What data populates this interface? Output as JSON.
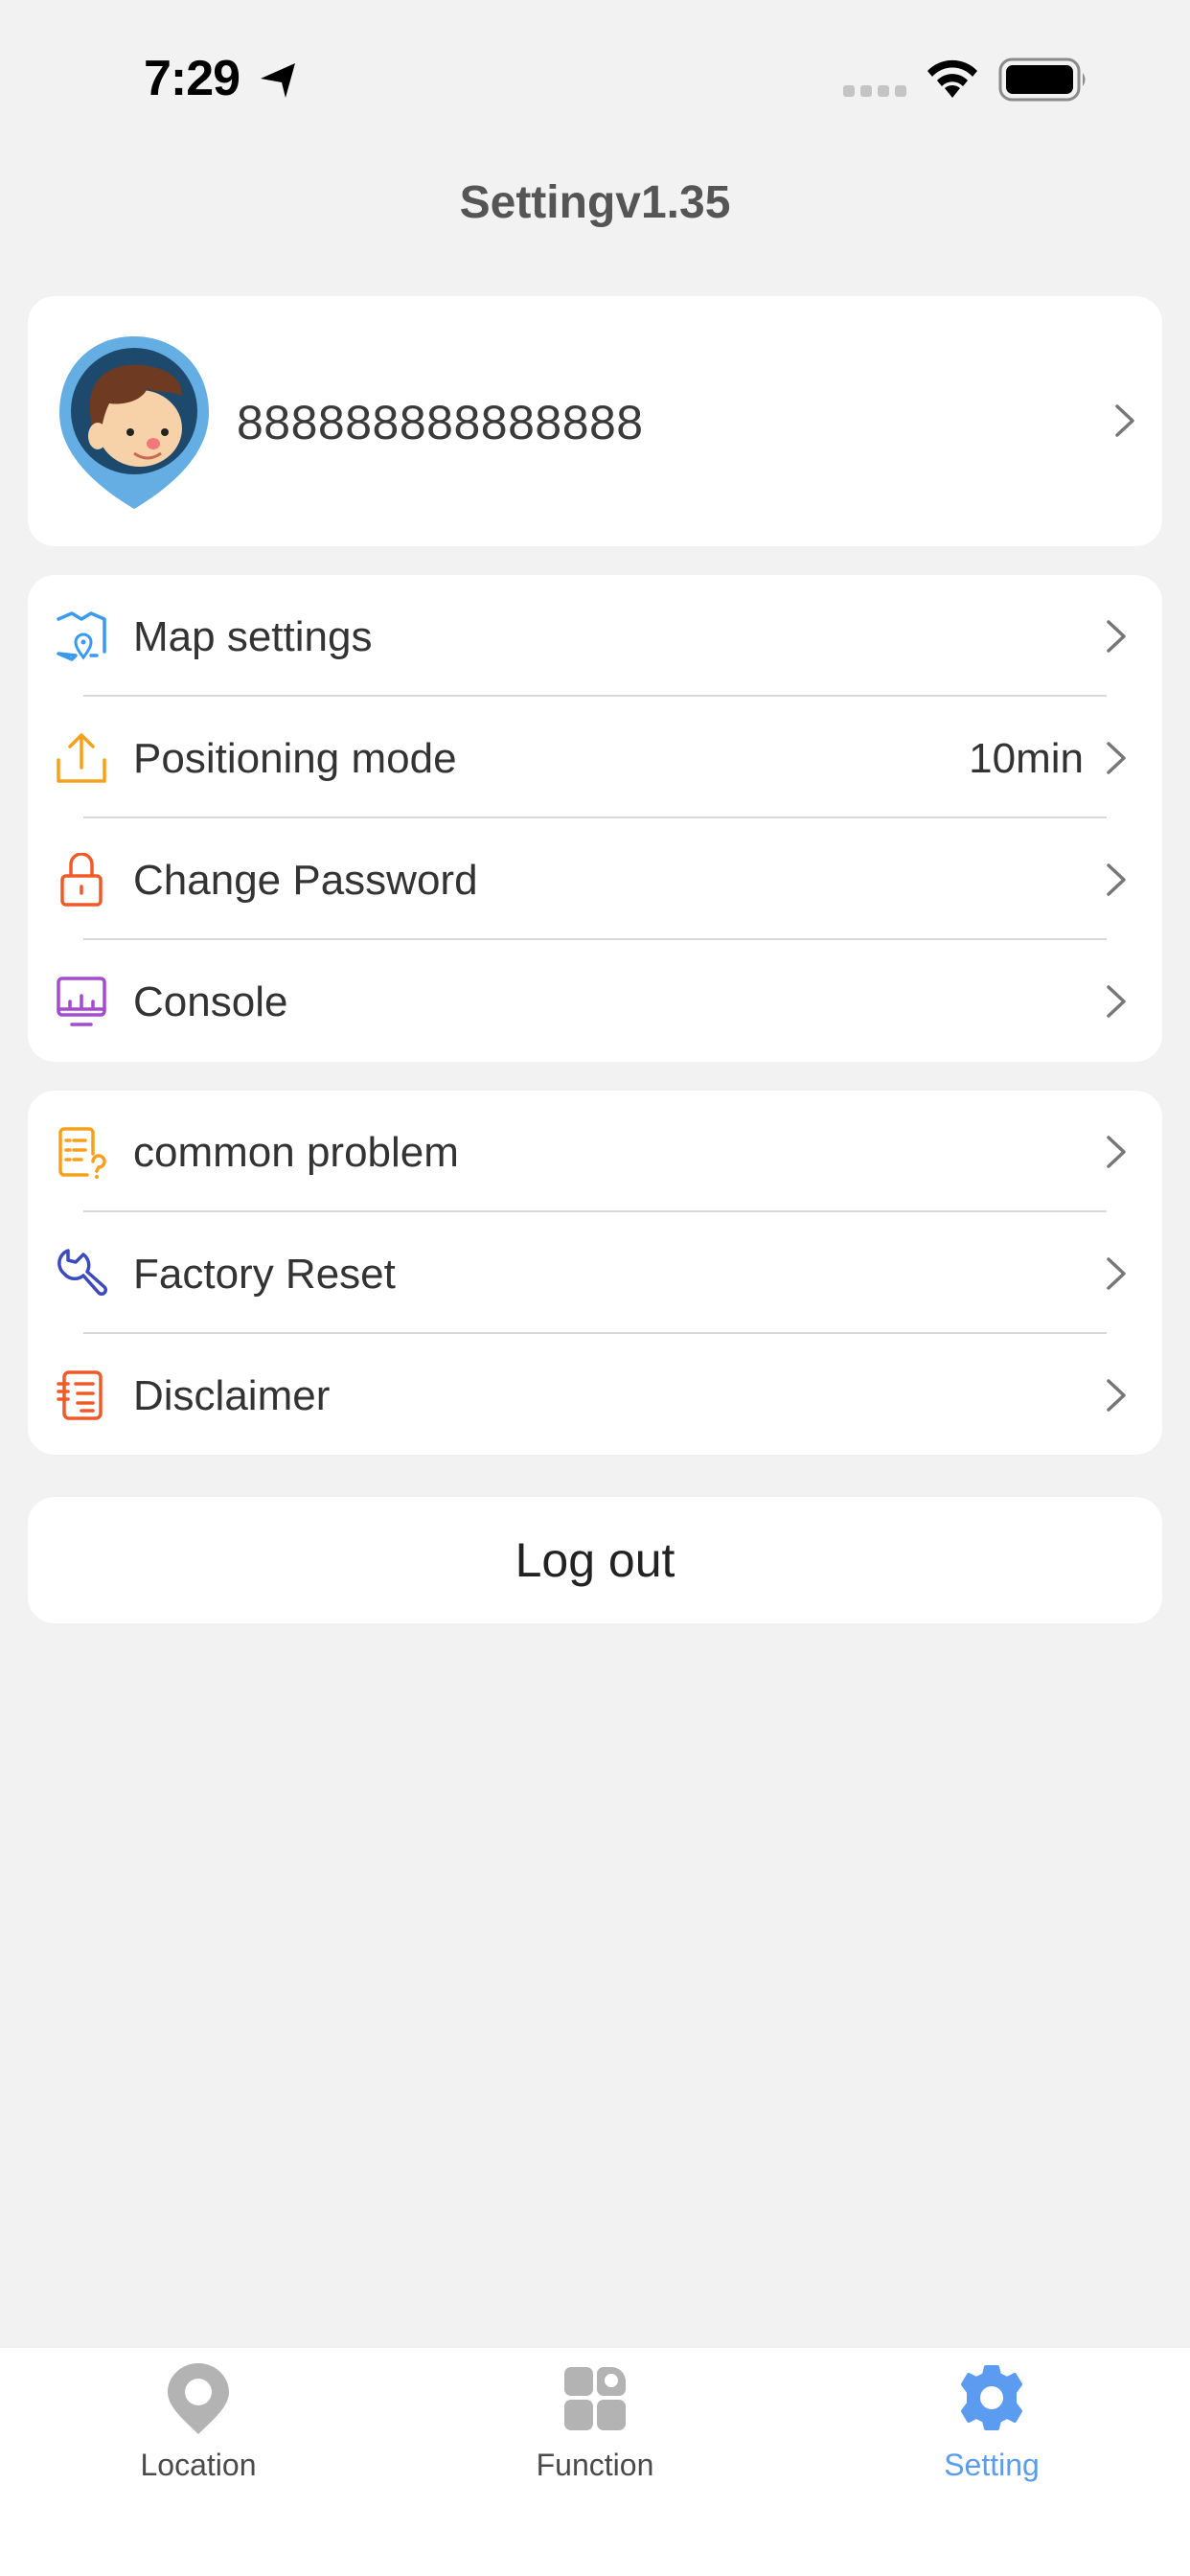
{
  "status_bar": {
    "time": "7:29",
    "location_icon": "location-arrow-icon",
    "signal_icon": "cellular-signal-icon",
    "wifi_icon": "wifi-icon",
    "battery_icon": "battery-full-icon"
  },
  "header": {
    "title": "Settingv1.35"
  },
  "profile": {
    "avatar_icon": "avatar-pin-icon",
    "name": "888888888888888",
    "chevron_icon": "chevron-right-icon"
  },
  "groups": [
    {
      "items": [
        {
          "label": "Map settings",
          "icon": "map-icon",
          "color": "#3a9af0",
          "value": ""
        },
        {
          "label": "Positioning mode",
          "icon": "upload-icon",
          "color": "#f5a11c",
          "value": "10min"
        },
        {
          "label": "Change Password",
          "icon": "lock-icon",
          "color": "#f05a28",
          "value": ""
        },
        {
          "label": "Console",
          "icon": "monitor-chart-icon",
          "color": "#a44bd0",
          "value": ""
        }
      ]
    },
    {
      "items": [
        {
          "label": "common problem",
          "icon": "faq-document-icon",
          "color": "#f5a11c",
          "value": ""
        },
        {
          "label": "Factory Reset",
          "icon": "wrench-icon",
          "color": "#3b4bbf",
          "value": ""
        },
        {
          "label": "Disclaimer",
          "icon": "notebook-icon",
          "color": "#f05a28",
          "value": ""
        }
      ]
    }
  ],
  "logout_label": "Log out",
  "tab_bar": {
    "tabs": [
      {
        "label": "Location",
        "icon": "location-pin-icon",
        "active": false
      },
      {
        "label": "Function",
        "icon": "function-grid-icon",
        "active": false
      },
      {
        "label": "Setting",
        "icon": "gear-icon",
        "active": true
      }
    ],
    "active_color": "#5b9cf0",
    "inactive_icon_color": "#b3b3b3"
  }
}
